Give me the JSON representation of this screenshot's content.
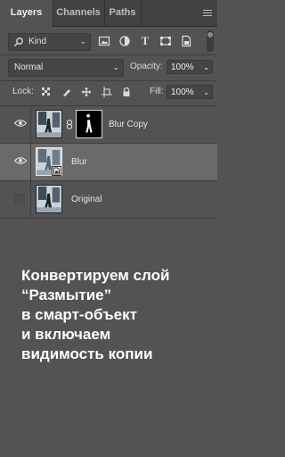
{
  "tabs": [
    {
      "label": "Layers",
      "active": true
    },
    {
      "label": "Channels",
      "active": false
    },
    {
      "label": "Paths",
      "active": false
    }
  ],
  "filter": {
    "kind_label": "Kind",
    "icons": [
      "pixel-filter-icon",
      "adjustment-filter-icon",
      "type-filter-icon",
      "shape-filter-icon",
      "smart-object-filter-icon"
    ]
  },
  "blend": {
    "mode": "Normal",
    "opacity_label": "Opacity:",
    "opacity_value": "100%"
  },
  "lock": {
    "label": "Lock:",
    "fill_label": "Fill:",
    "fill_value": "100%"
  },
  "layers": [
    {
      "name": "Blur Copy",
      "visible": true,
      "selected": false,
      "has_mask": true
    },
    {
      "name": "Blur",
      "visible": true,
      "selected": true,
      "smart_object": true
    },
    {
      "name": "Original",
      "visible": false,
      "selected": false
    }
  ],
  "caption": "Конвертируем слой\n“Размытие”\nв смарт-объект\nи включаем\nвидимость копии",
  "colors": {
    "panel": "#535353",
    "selected_row": "#6a6a6a",
    "tabbar": "#424242"
  }
}
